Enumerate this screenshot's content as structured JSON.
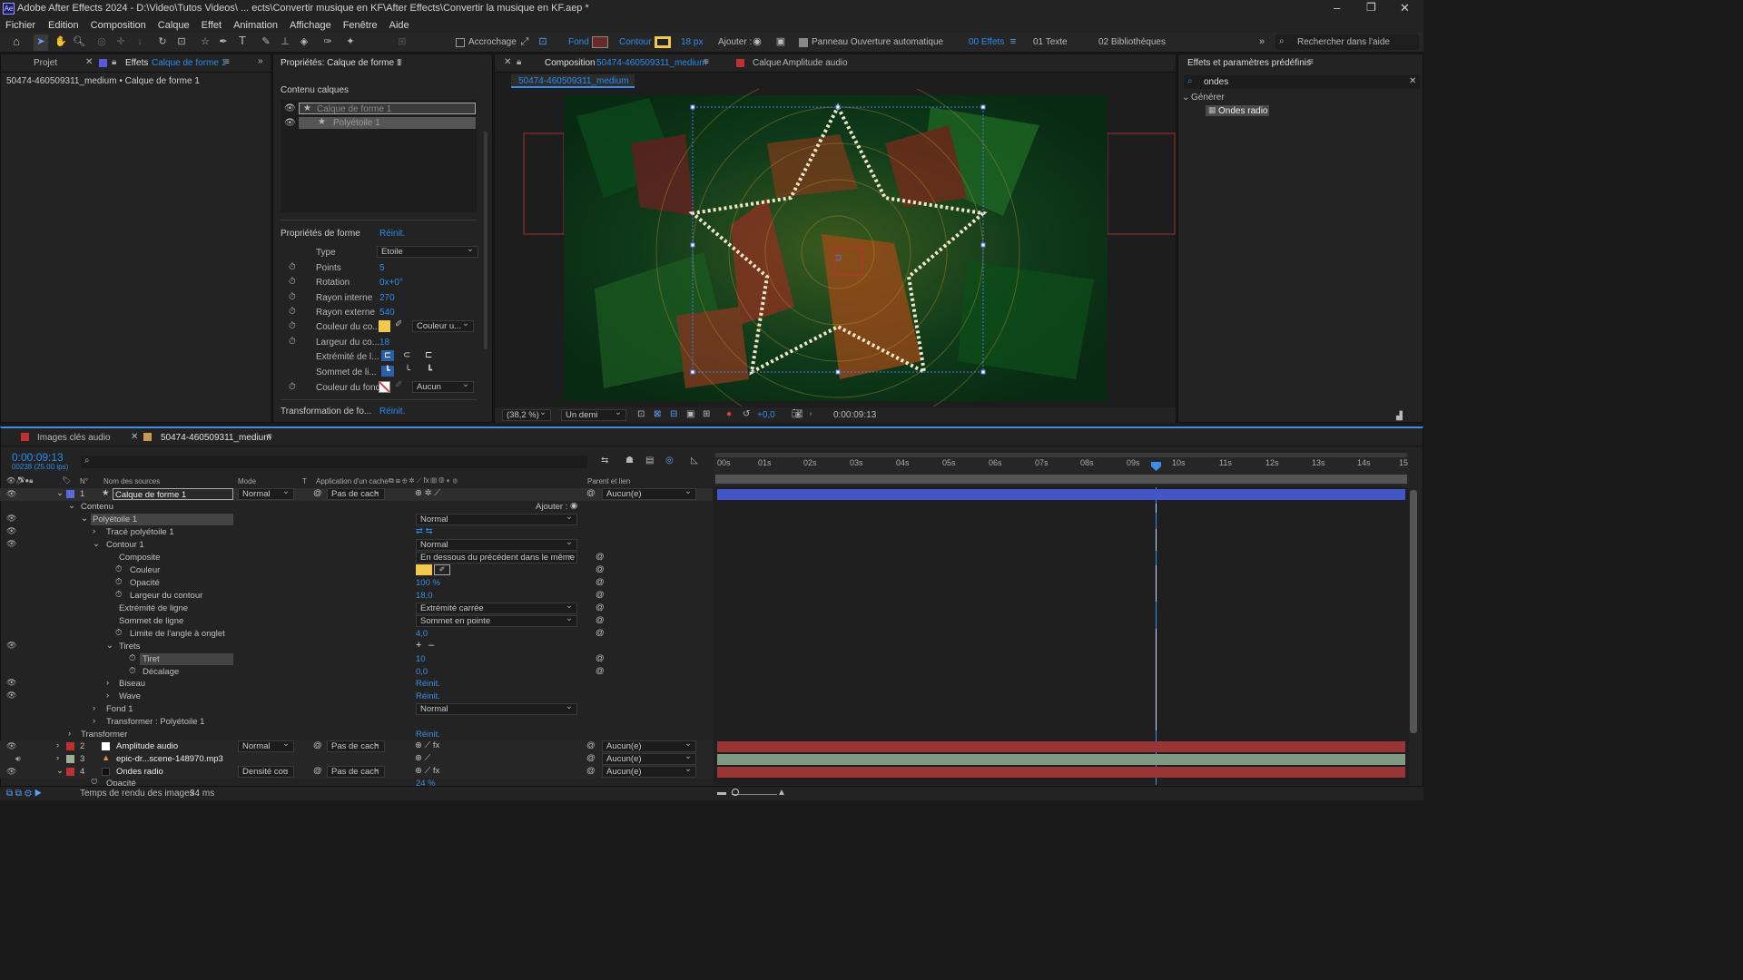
{
  "window": {
    "title": "Adobe After Effects 2024 - D:\\Video\\Tutos Videos\\ ... ects\\Convertir musique en KF\\After Effects\\Convertir la musique en KF.aep *"
  },
  "menu": [
    "Fichier",
    "Edition",
    "Composition",
    "Calque",
    "Effet",
    "Animation",
    "Affichage",
    "Fenêtre",
    "Aide"
  ],
  "toolbar": {
    "accrochage": "Accrochage",
    "fond": "Fond :",
    "contour": "Contour",
    "stroke_px": "18 px",
    "ajouter": "Ajouter :",
    "auto_open": "Panneau Ouverture automatique",
    "effets": "00 Effets",
    "texte": "01 Texte",
    "biblio": "02 Bibliothèques",
    "search": "Rechercher dans l'aide"
  },
  "left_panel": {
    "tab_projet": "Projet",
    "tab_effets": "Effets",
    "effets_layer": "Calque de forme 1",
    "breadcrumb": "50474-460509311_medium • Calque de forme 1"
  },
  "props": {
    "title": "Propriétés: Calque de forme 1",
    "contenu": "Contenu calques",
    "layer1": "Calque de forme 1",
    "layer2": "Polyétoile 1",
    "shape_props": "Propriétés de forme",
    "reinit": "Réinit.",
    "rows": [
      {
        "label": "Type",
        "value": "Etoile"
      },
      {
        "label": "Points",
        "value": "5"
      },
      {
        "label": "Rotation",
        "value": "0x+0°"
      },
      {
        "label": "Rayon interne",
        "value": "270"
      },
      {
        "label": "Rayon externe",
        "value": "540"
      },
      {
        "label": "Couleur du co...",
        "value": "Couleur u..."
      },
      {
        "label": "Largeur du co...",
        "value": "18"
      },
      {
        "label": "Extrémité de l...",
        "value": ""
      },
      {
        "label": "Sommet de li...",
        "value": ""
      },
      {
        "label": "Couleur du fond",
        "value": "Aucun"
      }
    ],
    "transform": "Transformation de fo...",
    "transform_reinit": "Réinit."
  },
  "comp": {
    "tab": "Composition",
    "tab_name": "50474-460509311_medium",
    "layer_tab": "Calque",
    "layer_name": "Amplitude audio",
    "sub": "50474-460509311_medium",
    "zoom": "(38,2 %)",
    "res": "Un demi",
    "exposure": "+0,0",
    "time": "0:00:09:13"
  },
  "effects_panel": {
    "title": "Effets et paramètres prédéfinis",
    "search": "ondes",
    "group": "Générer",
    "item": "Ondes radio"
  },
  "timeline": {
    "tab1": "Images clés audio",
    "tab2": "50474-460509311_medium",
    "time": "0:00:09:13",
    "fps": "00238 (25.00 ips)",
    "cols": {
      "num": "N°",
      "name": "Nom des sources",
      "mode": "Mode",
      "t": "T",
      "cache": "Application d'un cache",
      "parent": "Parent et lien"
    },
    "ticks": [
      "00s",
      "01s",
      "02s",
      "03s",
      "04s",
      "05s",
      "06s",
      "07s",
      "08s",
      "09s",
      "10s",
      "11s",
      "12s",
      "13s",
      "14s",
      "15"
    ],
    "layer1": {
      "num": "1",
      "name": "Calque de forme 1",
      "mode": "Normal",
      "cache": "Pas de cach",
      "parent": "Aucun(e)"
    },
    "contenu": "Contenu",
    "ajouter": "Ajouter :",
    "poly": "Polyétoile 1",
    "poly_mode": "Normal",
    "trace": "Tracé polyétoile 1",
    "contour": "Contour 1",
    "contour_mode": "Normal",
    "composite": "Composite",
    "composite_val": "En dessous du précédent dans le même",
    "couleur": "Couleur",
    "opacite": "Opacité",
    "opacite_val": "100 %",
    "largeur": "Largeur du contour",
    "largeur_val": "18,0",
    "extremite": "Extrémité de ligne",
    "extremite_val": "Extrémité carrée",
    "sommet": "Sommet de ligne",
    "sommet_val": "Sommet en pointe",
    "limite": "Limite de l'angle à onglet",
    "limite_val": "4,0",
    "tirets": "Tirets",
    "tiret": "Tiret",
    "tiret_val": "10",
    "decalage": "Décalage",
    "decalage_val": "0,0",
    "biseau": "Biseau",
    "biseau_val": "Réinit.",
    "wave": "Wave",
    "wave_val": "Réinit.",
    "fond": "Fond 1",
    "fond_val": "Normal",
    "transf_poly": "Transformer : Polyétoile 1",
    "transformer": "Transformer",
    "transformer_val": "Réinit.",
    "layer2": {
      "num": "2",
      "name": "Amplitude audio",
      "mode": "Normal",
      "cache": "Pas de cach",
      "parent": "Aucun(e)"
    },
    "layer3": {
      "num": "3",
      "name": "epic-dr...scene-148970.mp3",
      "parent": "Aucun(e)"
    },
    "layer4": {
      "num": "4",
      "name": "Ondes radio",
      "mode": "Densité cou",
      "cache": "Pas de cach",
      "parent": "Aucun(e)"
    },
    "opacite4": "Opacité",
    "opacite4_val": "24 %",
    "render": "Temps de rendu des images :",
    "render_val": "34 ms"
  },
  "colors": {
    "accent": "#2d8ceb",
    "star_fill": "#f2c94c",
    "track_blue": "#4256c8",
    "track_red": "#9a3535"
  }
}
